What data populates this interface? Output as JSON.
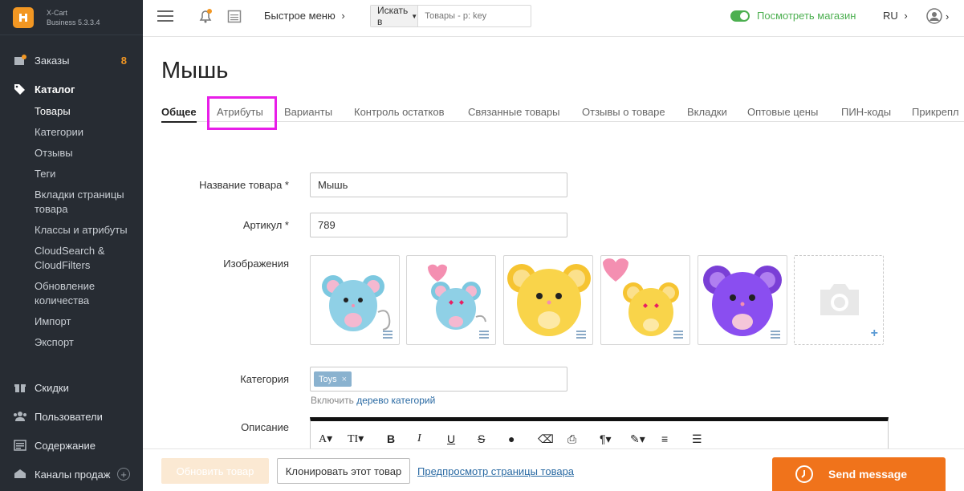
{
  "brand": {
    "name_line1": "X-Cart",
    "name_line2": "Business 5.3.3.4"
  },
  "sidebar": {
    "orders": {
      "label": "Заказы",
      "badge": "8"
    },
    "catalog": {
      "label": "Каталог",
      "items": [
        {
          "label": "Товары"
        },
        {
          "label": "Категории"
        },
        {
          "label": "Отзывы"
        },
        {
          "label": "Теги"
        },
        {
          "label": "Вкладки страницы товара"
        },
        {
          "label": "Классы и атрибуты"
        },
        {
          "label": "CloudSearch & CloudFilters"
        },
        {
          "label": "Обновление количества"
        },
        {
          "label": "Импорт"
        },
        {
          "label": "Экспорт"
        }
      ]
    },
    "discounts": {
      "label": "Скидки"
    },
    "users": {
      "label": "Пользователи"
    },
    "content": {
      "label": "Содержание"
    },
    "channels": {
      "label": "Каналы продаж"
    }
  },
  "topbar": {
    "quick_menu": "Быстрое меню",
    "search_select": "Искать в",
    "search_placeholder": "Товары - p: key",
    "view_store": "Посмотреть магазин",
    "lang": "RU"
  },
  "page": {
    "title": "Мышь",
    "tabs": [
      {
        "label": "Общее"
      },
      {
        "label": "Атрибуты"
      },
      {
        "label": "Варианты"
      },
      {
        "label": "Контроль остатков"
      },
      {
        "label": "Связанные товары"
      },
      {
        "label": "Отзывы о товаре"
      },
      {
        "label": "Вкладки"
      },
      {
        "label": "Оптовые цены"
      },
      {
        "label": "ПИН-коды"
      },
      {
        "label": "Прикрепл"
      }
    ]
  },
  "form": {
    "name_label": "Название товара *",
    "name_value": "Мышь",
    "sku_label": "Артикул *",
    "sku_value": "789",
    "images_label": "Изображения",
    "category_label": "Категория",
    "category_chip": "Toys",
    "category_hint_prefix": "Включить",
    "category_hint_link": "дерево категорий",
    "description_label": "Описание"
  },
  "bottombar": {
    "update_button": "Обновить товар",
    "clone_button": "Клонировать этот товар",
    "preview_link": "Предпросмотр страницы товара"
  },
  "chat": {
    "label": "Send message"
  },
  "colors": {
    "accent": "#f29723",
    "sidebar_bg": "#272c33",
    "highlight": "#e81ee8",
    "chat": "#f0731b",
    "store_green": "#4caf50"
  }
}
